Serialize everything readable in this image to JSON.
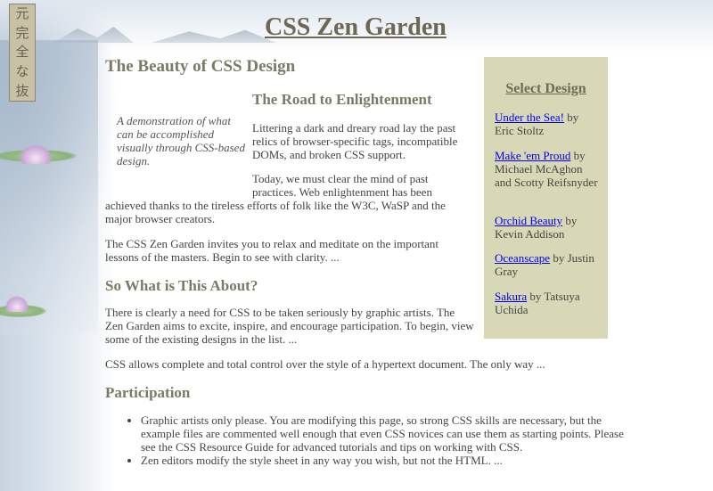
{
  "page": {
    "title": "CSS Zen Garden"
  },
  "seal": {
    "chars": [
      "元",
      "完",
      "全",
      "な",
      "抜"
    ]
  },
  "main": {
    "heading": "The Beauty of CSS Design",
    "tagline": "A demonstration of what can be accomplished visually through CSS-based design.",
    "road_heading": "The Road to Enlightenment",
    "road_p1": "Littering a dark and dreary road lay the past relics of browser-specific tags, incompatible DOMs, and broken CSS support.",
    "road_p2a": "Today, we must clear the mind of past practices. Web enlightenment has been",
    "road_p2b": "achieved thanks to the tireless efforts of folk like the W3C, WaSP and the major browser creators.",
    "road_p3": "The CSS Zen Garden invites you to relax and meditate on the important lessons of the masters. Begin to see with clarity. ...",
    "about_heading": "So What is This About?",
    "about_p1": "There is clearly a need for CSS to be taken seriously by graphic artists. The Zen Garden aims to excite, inspire, and encourage participation. To begin, view some of the existing designs in the list. ...",
    "about_p2": "CSS allows complete and total control over the style of a hypertext document. The only way ...",
    "participation_heading": "Participation",
    "participation_items": [
      "Graphic artists only please. You are modifying this page, so strong CSS skills are necessary, but the example files are commented well enough that even CSS novices can use them as starting points. Please see the CSS Resource Guide for advanced tutorials and tips on working with CSS.",
      "Zen editors modify the style sheet in any way you wish, but not the HTML. ..."
    ]
  },
  "sidebar": {
    "title": "Select Design",
    "designs": [
      {
        "name": "Under the Sea!",
        "by": "by Eric Stoltz"
      },
      {
        "name": "Make 'em Proud",
        "by": "by Michael McAghon and Scotty Reifsnyder"
      },
      {
        "name": "Orchid Beauty",
        "by": "by Kevin Addison"
      },
      {
        "name": "Oceanscape",
        "by": "by Justin Gray"
      },
      {
        "name": "Sakura",
        "by": "by Tatsuya Uchida"
      }
    ]
  }
}
